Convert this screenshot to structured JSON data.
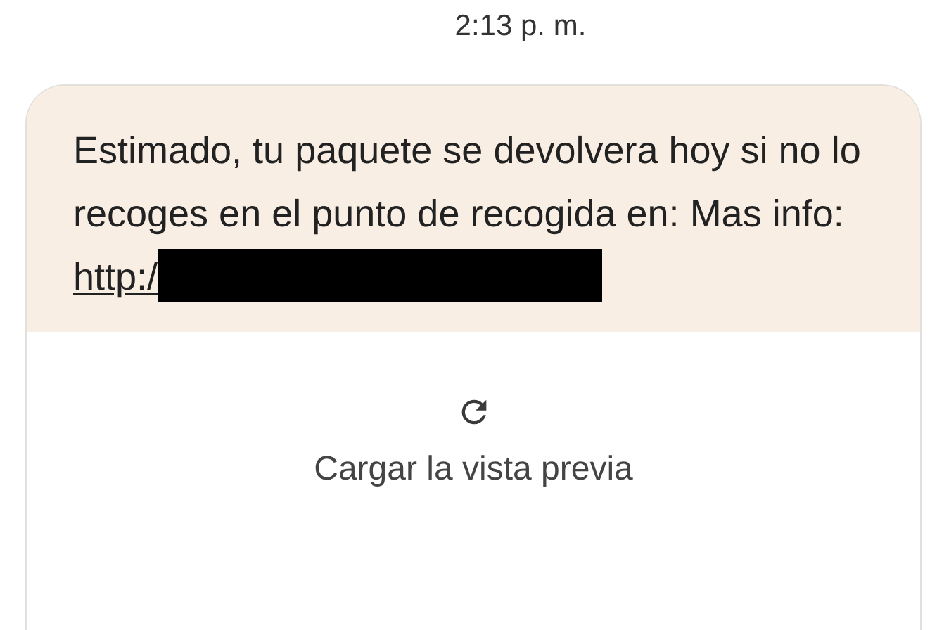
{
  "timestamp": "2:13 p. m.",
  "message": {
    "text": "Estimado, tu paquete se devolvera hoy si no lo recoges en el punto de recogida en: Mas info:",
    "link": "http:/",
    "redacted": true
  },
  "preview": {
    "label": "Cargar la vista previa"
  }
}
